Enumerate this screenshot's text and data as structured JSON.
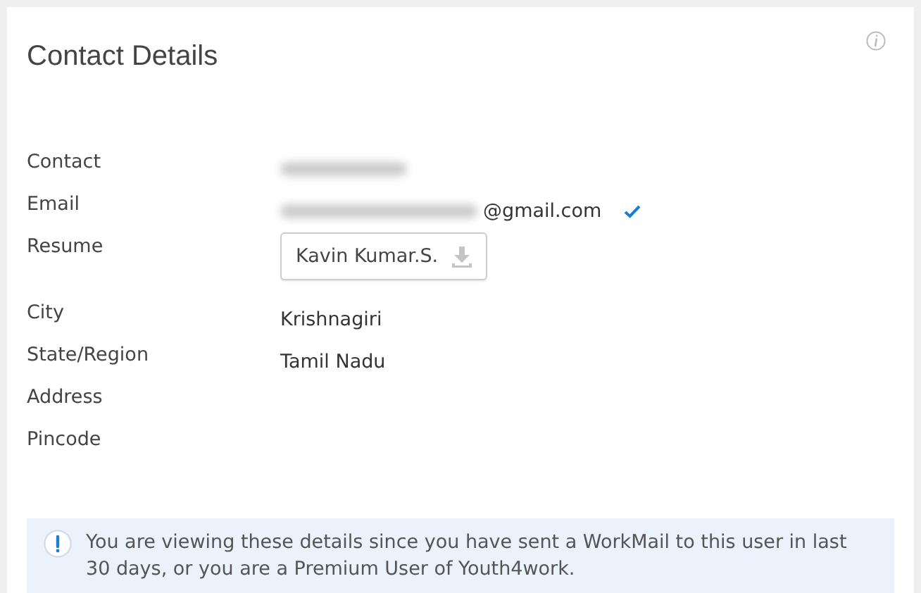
{
  "card": {
    "title": "Contact Details"
  },
  "fields": [
    {
      "label": "Contact",
      "kind": "redacted"
    },
    {
      "label": "Email",
      "kind": "email",
      "value": "@gmail.com",
      "verified": true
    },
    {
      "label": "Resume",
      "kind": "file",
      "value": "Kavin Kumar.S."
    },
    {
      "label": "City",
      "kind": "text",
      "value": "Krishnagiri"
    },
    {
      "label": "State/Region",
      "kind": "text",
      "value": "Tamil Nadu"
    },
    {
      "label": "Address",
      "kind": "empty"
    },
    {
      "label": "Pincode",
      "kind": "empty"
    }
  ],
  "notice": {
    "text": "You are viewing these details since you have sent a WorkMail to this user in last 30 days, or you are a Premium User of Youth4work."
  }
}
